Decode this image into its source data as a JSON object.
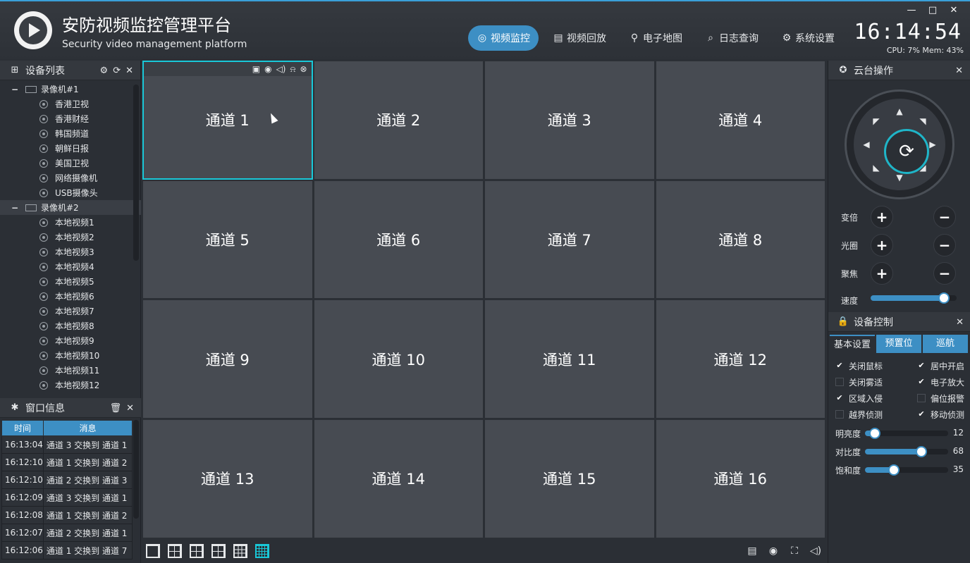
{
  "app": {
    "title": "安防视频监控管理平台",
    "subtitle": "Security video management platform",
    "clock": "16:14:54",
    "sys_stats": "CPU: 7% Mem: 43%",
    "window_controls": [
      "—",
      "□",
      "✕"
    ]
  },
  "nav": [
    {
      "label": "视频监控",
      "icon": "camera-icon",
      "glyph": "◎",
      "active": true
    },
    {
      "label": "视频回放",
      "icon": "film-icon",
      "glyph": "▤",
      "active": false
    },
    {
      "label": "电子地图",
      "icon": "map-pin-icon",
      "glyph": "⚲",
      "active": false
    },
    {
      "label": "日志查询",
      "icon": "search-icon",
      "glyph": "⌕",
      "active": false
    },
    {
      "label": "系统设置",
      "icon": "gears-icon",
      "glyph": "⚙",
      "active": false
    }
  ],
  "device_list": {
    "title": "设备列表",
    "groups": [
      {
        "name": "录像机#1",
        "items": [
          "香港卫视",
          "香港财经",
          "韩国频道",
          "朝鲜日报",
          "美国卫视",
          "网络摄像机",
          "USB摄像头"
        ]
      },
      {
        "name": "录像机#2",
        "items": [
          "本地视频1",
          "本地视频2",
          "本地视频3",
          "本地视频4",
          "本地视频5",
          "本地视频6",
          "本地视频7",
          "本地视频8",
          "本地视频9",
          "本地视频10",
          "本地视频11",
          "本地视频12"
        ]
      }
    ]
  },
  "window_info": {
    "title": "窗口信息",
    "columns": [
      "时间",
      "消息"
    ],
    "rows": [
      {
        "time": "16:13:04",
        "msg": "通道 3 交换到 通道 1"
      },
      {
        "time": "16:12:10",
        "msg": "通道 1 交换到 通道 2"
      },
      {
        "time": "16:12:10",
        "msg": "通道 2 交换到 通道 3"
      },
      {
        "time": "16:12:09",
        "msg": "通道 3 交换到 通道 1"
      },
      {
        "time": "16:12:08",
        "msg": "通道 1 交换到 通道 2"
      },
      {
        "time": "16:12:07",
        "msg": "通道 2 交换到 通道 1"
      },
      {
        "time": "16:12:06",
        "msg": "通道 1 交换到 通道 7"
      }
    ]
  },
  "channels": [
    "通道 1",
    "通道 2",
    "通道 3",
    "通道 4",
    "通道 5",
    "通道 6",
    "通道 7",
    "通道 8",
    "通道 9",
    "通道 10",
    "通道 11",
    "通道 12",
    "通道 13",
    "通道 14",
    "通道 15",
    "通道 16"
  ],
  "active_channel": 0,
  "channel_toolbar": [
    "▣",
    "◉",
    "◁)",
    "⍾",
    "⊗"
  ],
  "layouts": [
    "1x1",
    "2x2",
    "1+5",
    "1+7",
    "3x3",
    "4x4"
  ],
  "active_layout": 5,
  "bottom_tools": [
    "▤",
    "◉",
    "⛶",
    "◁)"
  ],
  "ptz": {
    "title": "云台操作",
    "rows": [
      {
        "label": "变倍"
      },
      {
        "label": "光圈"
      },
      {
        "label": "聚焦"
      }
    ],
    "speed_label": "速度",
    "speed_value": 0.85
  },
  "device_control": {
    "title": "设备控制",
    "tabs": [
      "基本设置",
      "预置位",
      "巡航"
    ],
    "active_tab": 0,
    "checkboxes": [
      {
        "label": "关闭鼠标",
        "checked": true
      },
      {
        "label": "居中开启",
        "checked": true
      },
      {
        "label": "关闭雾适",
        "checked": false
      },
      {
        "label": "电子放大",
        "checked": true
      },
      {
        "label": "区域入侵",
        "checked": true
      },
      {
        "label": "偏位报警",
        "checked": false
      },
      {
        "label": "越界侦测",
        "checked": false
      },
      {
        "label": "移动侦测",
        "checked": true
      }
    ],
    "adjustments": [
      {
        "label": "明亮度",
        "value": 12
      },
      {
        "label": "对比度",
        "value": 68
      },
      {
        "label": "饱和度",
        "value": 35
      }
    ]
  },
  "colors": {
    "accent": "#3d8fc4",
    "active_border": "#19c8d8",
    "channel_bg": "#474b52"
  }
}
